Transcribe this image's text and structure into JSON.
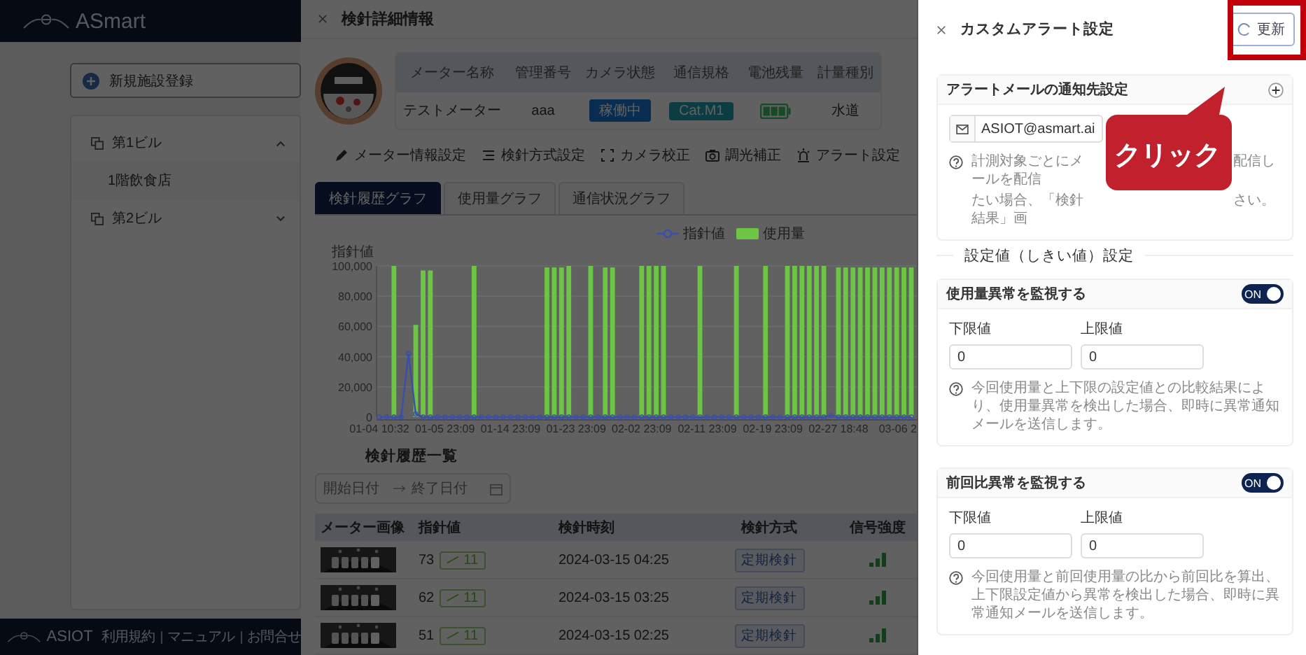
{
  "sidebar": {
    "logo": "ASmart",
    "new_button": "新規施設登録",
    "tree": [
      {
        "label": "第1ビル",
        "expanded": true,
        "children": [
          {
            "label": "1階飲食店"
          }
        ]
      },
      {
        "label": "第2ビル",
        "expanded": false
      }
    ],
    "footer": {
      "logo": "ASIOT",
      "links": [
        "利用規約",
        "マニュアル",
        "お問合せ"
      ]
    }
  },
  "meter": {
    "title": "検針詳細情報",
    "info_columns": [
      "メーター名称",
      "管理番号",
      "カメラ状態",
      "通信規格",
      "電池残量",
      "計量種別"
    ],
    "info_values": [
      {
        "kind": "text",
        "text": "テストメーター"
      },
      {
        "kind": "text",
        "text": "aaa"
      },
      {
        "kind": "badge",
        "text": "稼働中",
        "color": "#082d50"
      },
      {
        "kind": "badge",
        "text": "Cat.M1",
        "color": "#0c3d43"
      },
      {
        "kind": "battery"
      },
      {
        "kind": "text",
        "text": "水道"
      }
    ],
    "actions": [
      "メーター情報設定",
      "検針方式設定",
      "カメラ校正",
      "調光補正",
      "アラート設定"
    ],
    "tabs": [
      {
        "label": "検針履歴グラフ",
        "selected": true
      },
      {
        "label": "使用量グラフ",
        "selected": false
      },
      {
        "label": "通信状況グラフ",
        "selected": false
      }
    ],
    "chart_data": {
      "type": "bar",
      "grid": true,
      "legend": "top-right",
      "ylabel": "指針値",
      "ylim": [
        0,
        100000
      ],
      "yticks": [
        {
          "value": 0,
          "label": "0"
        },
        {
          "value": 20000,
          "label": "20,000"
        },
        {
          "value": 40000,
          "label": "40,000"
        },
        {
          "value": 60000,
          "label": "60,000"
        },
        {
          "value": 80000,
          "label": "80,000"
        },
        {
          "value": 100000,
          "label": "100,000"
        }
      ],
      "categories": [
        "01-04 10:32",
        null,
        null,
        null,
        null,
        null,
        null,
        null,
        null,
        "01-05 23:09",
        null,
        null,
        null,
        null,
        null,
        null,
        null,
        null,
        "01-14 23:09",
        null,
        null,
        null,
        null,
        null,
        null,
        null,
        null,
        "01-23 23:09",
        null,
        null,
        null,
        null,
        null,
        null,
        null,
        null,
        "02-02 23:09",
        null,
        null,
        null,
        null,
        null,
        null,
        null,
        null,
        "02-11 23:09",
        null,
        null,
        null,
        null,
        null,
        null,
        null,
        null,
        "02-19 23:09",
        null,
        null,
        null,
        null,
        null,
        null,
        null,
        null,
        "02-27 18:48",
        null,
        null,
        null,
        null,
        null,
        null,
        null,
        null,
        "03-06 2",
        null
      ],
      "series": [
        {
          "name": "指針値",
          "color": "#3b4fa8",
          "type": "line",
          "marker": true,
          "values": [
            0,
            0,
            0,
            0,
            42000,
            2000,
            0,
            0,
            0,
            0,
            0,
            0,
            0,
            0,
            0,
            0,
            0,
            0,
            0,
            0,
            0,
            0,
            0,
            0,
            0,
            0,
            0,
            0,
            0,
            0,
            0,
            0,
            0,
            0,
            0,
            0,
            0,
            0,
            0,
            0,
            0,
            0,
            0,
            0,
            0,
            0,
            0,
            0,
            0,
            0,
            0,
            0,
            0,
            0,
            0,
            0,
            0,
            0,
            0,
            0,
            0,
            0,
            1000,
            0,
            0,
            0,
            0,
            0,
            0,
            0,
            0,
            0,
            0,
            0
          ]
        },
        {
          "name": "使用量",
          "color": "#6cc644",
          "type": "bar",
          "values": [
            0,
            0,
            100000,
            0,
            0,
            61000,
            97000,
            97000,
            0,
            0,
            0,
            0,
            0,
            100000,
            0,
            0,
            0,
            0,
            0,
            0,
            0,
            0,
            0,
            99000,
            99000,
            99000,
            100000,
            0,
            0,
            100000,
            0,
            99000,
            99000,
            0,
            0,
            0,
            100000,
            100000,
            100000,
            100000,
            0,
            0,
            0,
            0,
            100000,
            0,
            0,
            0,
            0,
            100000,
            0,
            0,
            0,
            100000,
            0,
            0,
            100000,
            100000,
            100000,
            100000,
            100000,
            100000,
            0,
            99000,
            99000,
            99000,
            99000,
            99000,
            99000,
            99000,
            99000,
            99000,
            99000,
            99000
          ]
        }
      ]
    },
    "history": {
      "title": "検針履歴一覧",
      "start_placeholder": "開始日付",
      "end_placeholder": "終了日付",
      "columns": [
        "メーター画像",
        "指針値",
        "検針時刻",
        "検針方式",
        "信号強度"
      ],
      "rows": [
        {
          "reading": "73",
          "delta": "11",
          "time": "2024-03-15 04:25",
          "method": "定期検針"
        },
        {
          "reading": "62",
          "delta": "11",
          "time": "2024-03-15 03:25",
          "method": "定期検針"
        },
        {
          "reading": "51",
          "delta": "11",
          "time": "2024-03-15 02:25",
          "method": "定期検針"
        }
      ]
    }
  },
  "alert_panel": {
    "title": "カスタムアラート設定",
    "refresh_button": "更新",
    "email_card": {
      "title": "アラートメールの通知先設定",
      "email": "ASIOT@asmart.ai",
      "note_lines": [
        {
          "left": "計測対象ごとにメールを配信",
          "right": "配信し"
        },
        {
          "left": "たい場合、「検針結果」画",
          "right": "さい。"
        }
      ]
    },
    "threshold_heading": "設定値（しきい値）設定",
    "monitors": [
      {
        "title": "使用量異常を監視する",
        "on": true,
        "toggle_label": "ON",
        "lower_label": "下限値",
        "lower": "0",
        "upper_label": "上限値",
        "upper": "0",
        "note": "今回使用量と上下限の設定値との比較結果により、使用量異常を検出した場合、即時に異常通知メールを送信します。"
      },
      {
        "title": "前回比異常を監視する",
        "on": true,
        "toggle_label": "ON",
        "lower_label": "下限値",
        "lower": "0",
        "upper_label": "上限値",
        "upper": "0",
        "note": "今回使用量と前回使用量の比から前回比を算出、上下限設定値から異常を検出した場合、即時に異常通知メールを送信します。"
      }
    ]
  },
  "callout": "クリック"
}
